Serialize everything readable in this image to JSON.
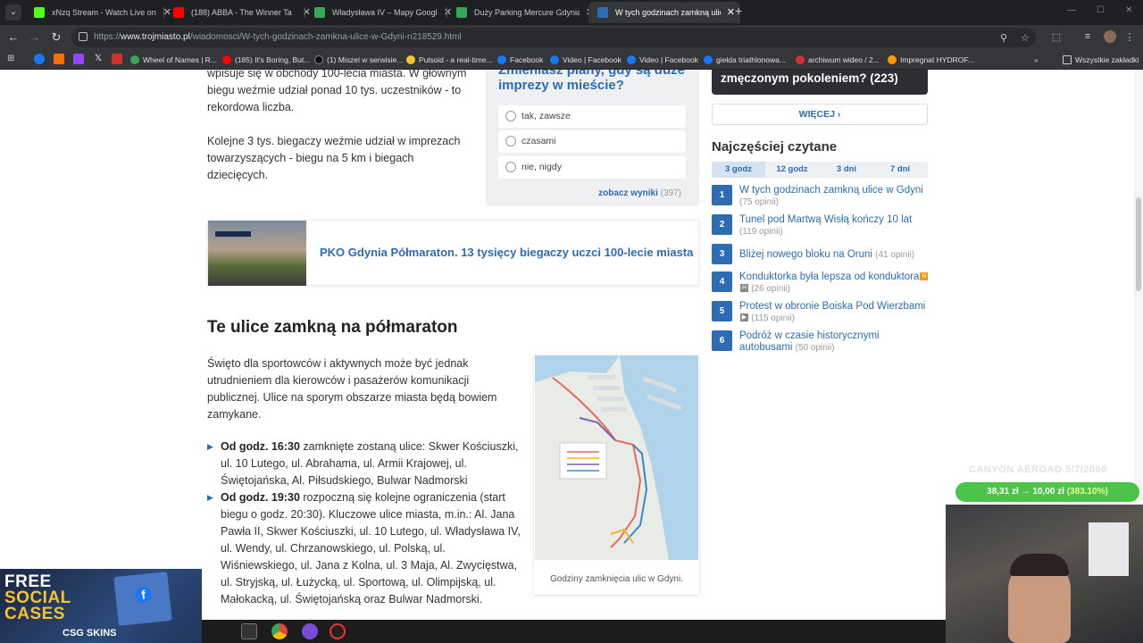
{
  "browser": {
    "tabs": [
      {
        "label": "xNzq Stream - Watch Live on K",
        "active": false,
        "color": "#53fc18"
      },
      {
        "label": "(188) ABBA - The Winner Ta",
        "active": false,
        "color": "#ff0000"
      },
      {
        "label": "Władysława IV – Mapy Google",
        "active": false,
        "color": "#34a853"
      },
      {
        "label": "Duży Parking Mercure Gdynia C",
        "active": false,
        "color": "#34a853"
      },
      {
        "label": "W tych godzinach zamkną ulice",
        "active": true,
        "color": "#2d6cb5"
      }
    ],
    "url_prefix": "https://",
    "url_domain": "www.trojmiasto.pl",
    "url_path": "/wiadomosci/W-tych-godzinach-zamkna-ulice-w-Gdyni-n218529.html",
    "bookmarks": [
      {
        "label": "Wheel of Names | R...",
        "color": "#34a853"
      },
      {
        "label": "(185) It's Boring, But...",
        "color": "#ff0000"
      },
      {
        "label": "(1) Miszel w serwisie...",
        "color": "#111111"
      },
      {
        "label": "Pulsoid - a real-time...",
        "color": "#f4c430"
      },
      {
        "label": "Facebook",
        "color": "#1877f2"
      },
      {
        "label": "Video | Facebook",
        "color": "#1877f2"
      },
      {
        "label": "Video | Facebook",
        "color": "#1877f2"
      },
      {
        "label": "giełda triathlonowa...",
        "color": "#1877f2"
      },
      {
        "label": "archiwum wideo / 2...",
        "color": "#d32f2f"
      },
      {
        "label": "Impregnat HYDROF...",
        "color": "#ff9900"
      }
    ],
    "all_bookmarks_label": "Wszystkie zakładki"
  },
  "article": {
    "para1": "wpisuje się w obchody 100-lecia miasta. W głównym biegu weźmie udział ponad 10 tys. uczestników - to rekordowa liczba.",
    "para2": "Kolejne 3 tys. biegaczy weźmie udział w imprezach towarzyszących - biegu na 5 km i biegach dziecięcych.",
    "related_title": "PKO Gdynia Półmaraton. 13 tysięcy biegaczy uczci 100-lecie miasta",
    "heading": "Te ulice zamkną na półmaraton",
    "intro": "Święto dla sportowców i aktywnych może być jednak utrudnieniem dla kierowców i pasażerów komunikacji publicznej. Ulice na sporym obszarze miasta będą bowiem zamykane.",
    "bullet1_bold": "Od godz. 16:30",
    "bullet1_text": " zamknięte zostaną ulice: Skwer Kościuszki, ul. 10 Lutego, ul. Abrahama, ul. Armii Krajowej, ul. Świętojańska, Al. Piłsudskiego, Bulwar Nadmorski",
    "bullet2_bold": "Od godz. 19:30",
    "bullet2_text": " rozpoczną się kolejne ograniczenia (start biegu o godz. 20:30). Kluczowe ulice miasta, m.in.: Al. Jana Pawła II, Skwer Kościuszki, ul. 10 Lutego, ul. Władysława IV, ul. Wendy, ul. Chrzanowskiego, ul. Polską, ul. Wiśniewskiego, ul. Jana z Kolna, ul. 3 Maja, Al. Zwycięstwa, ul. Stryjską, ul. Łużycką, ul. Sportową, ul. Olimpijską, ul. Małokacką, ul. Świętojańską oraz Bulwar Nadmorski.",
    "map_caption": "Godziny zamknięcia ulic w Gdyni."
  },
  "poll": {
    "title": "Zmieniasz plany, gdy są duże imprezy w mieście?",
    "options": [
      "tak, zawsze",
      "czasami",
      "nie, nigdy"
    ],
    "results_label": "zobacz wyniki",
    "results_count": "(397)"
  },
  "sidebar": {
    "banner_text": "zmęczonym pokoleniem? (223)",
    "more_label": "WIĘCEJ",
    "heading": "Najczęściej czytane",
    "tabs": [
      "3 godz",
      "12 godz",
      "3 dni",
      "7 dni"
    ],
    "items": [
      {
        "num": "1",
        "title": "W tych godzinach zamkną ulice w Gdyni",
        "opinions": "(75 opinii)"
      },
      {
        "num": "2",
        "title": "Tunel pod Martwą Wisłą kończy 10 lat",
        "opinions": "(119 opinii)"
      },
      {
        "num": "3",
        "title": "Bliżej nowego bloku na Oruni",
        "opinions": "(41 opinii)"
      },
      {
        "num": "4",
        "title": "Konduktorka była lepsza od konduktora",
        "opinions": "(26 opinii)"
      },
      {
        "num": "5",
        "title": "Protest w obronie Boiska Pod Wierzbami",
        "opinions": "(115 opinii)"
      },
      {
        "num": "6",
        "title": "Podróż w czasie historycznymi autobusami",
        "opinions": "(50 opinii)"
      }
    ]
  },
  "overlay": {
    "promo_line1": "FREE",
    "promo_line2": "SOCIAL",
    "promo_line3": "CASES",
    "promo_brand": "CSG SKINS",
    "bike_label": "CANYON AEROAD 5/7/2000",
    "profit": "38,31 zł",
    "profit_arrow": "→",
    "profit_base": "10,00 zł",
    "profit_pct": "(383.10%)"
  },
  "colors": {
    "accent": "#2d6cb5",
    "profit": "#4cc44a"
  }
}
